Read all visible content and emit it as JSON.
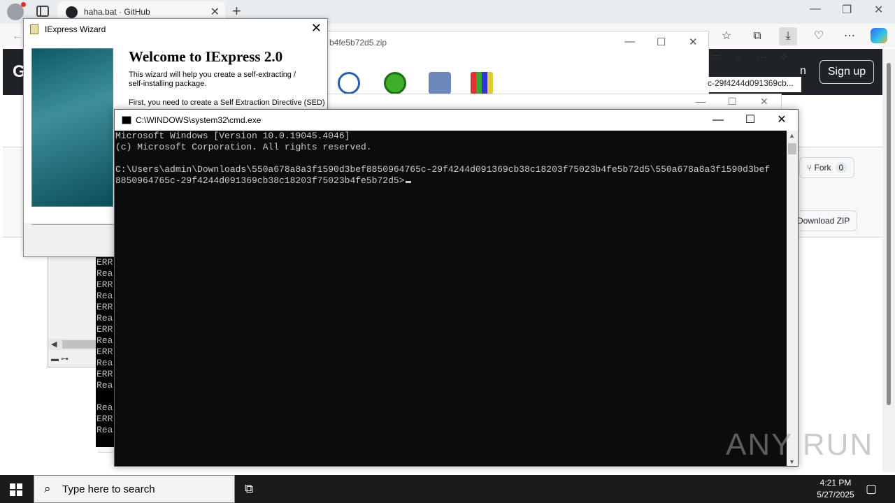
{
  "browser": {
    "tab_title": "haha.bat · GitHub",
    "new_tab_glyph": "+",
    "close_glyph": "✕",
    "toolbar_icons": [
      "back-icon",
      "favorites-icon",
      "collections-icon",
      "download-icon",
      "extensions-icon",
      "more-icon",
      "copilot-icon"
    ]
  },
  "github": {
    "logo": "G",
    "sign_in": "n",
    "sign_up": "Sign up",
    "fork_label": "Fork",
    "fork_count": "0",
    "download_zip": "Download ZIP"
  },
  "archive": {
    "title_fragment": "b4fe5b72d5.zip",
    "path_fragment": "c-29f4244d091369cb..."
  },
  "log_window": {
    "lines": [
      "ERR",
      "Rea",
      "ERR",
      "Rea",
      "ERR",
      "Rea",
      "ERR",
      "Rea",
      "ERR",
      "Rea",
      "ERR",
      "Rea",
      "",
      "Rea",
      "ERR",
      "Rea"
    ]
  },
  "iexpress": {
    "title": "IExpress Wizard",
    "heading": "Welcome to IExpress 2.0",
    "text1": "This wizard will help you create a self-extracting / self-installing package.",
    "text2": "First, you need to create a Self Extraction Directive (SED)"
  },
  "cmd": {
    "title": "C:\\WINDOWS\\system32\\cmd.exe",
    "lines": [
      "Microsoft Windows [Version 10.0.19045.4046]",
      "(c) Microsoft Corporation. All rights reserved.",
      "",
      "C:\\Users\\admin\\Downloads\\550a678a8a3f1590d3bef8850964765c-29f4244d091369cb38c18203f75023b4fe5b72d5\\550a678a8a3f1590d3bef",
      "8850964765c-29f4244d091369cb38c18203f75023b4fe5b72d5>"
    ]
  },
  "watermark": "ANY RUN",
  "taskbar": {
    "search_placeholder": "Type here to search",
    "time": "4:21 PM",
    "date": "5/27/2025"
  }
}
